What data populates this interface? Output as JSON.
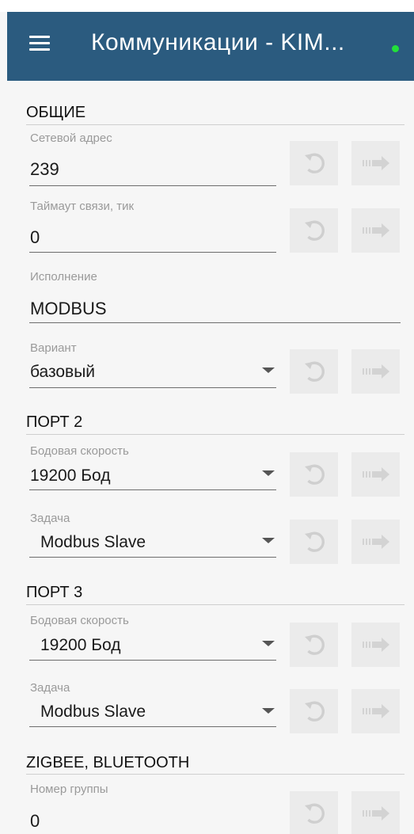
{
  "app_bar": {
    "title": "Коммуникации - KIM...",
    "status_color": "#22e03a"
  },
  "sections": {
    "general": {
      "title": "ОБЩИЕ",
      "network_address": {
        "label": "Сетевой адрес",
        "value": "239"
      },
      "timeout": {
        "label": "Таймаут связи, тик",
        "value": "0"
      },
      "execution": {
        "label": "Исполнение",
        "value": "MODBUS"
      },
      "variant": {
        "label": "Вариант",
        "value": "базовый"
      }
    },
    "port2": {
      "title": "ПОРТ 2",
      "baud_rate": {
        "label": "Бодовая скорость",
        "value": "19200 Бод"
      },
      "task": {
        "label": "Задача",
        "value": "Modbus Slave"
      }
    },
    "port3": {
      "title": "ПОРТ 3",
      "baud_rate": {
        "label": "Бодовая скорость",
        "value": "19200 Бод"
      },
      "task": {
        "label": "Задача",
        "value": "Modbus Slave"
      }
    },
    "zigbee": {
      "title": "ZIGBEE, BLUETOOTH",
      "group_number": {
        "label": "Номер группы",
        "value": "0"
      }
    }
  },
  "icons": {
    "menu": "menu-icon",
    "reset": "undo-icon",
    "apply": "arrow-right-icon"
  },
  "colors": {
    "app_bar": "#2b5b7f",
    "background": "#f6f6f6",
    "button_bg": "#ebebeb",
    "icon_disabled": "#cfcfcf"
  }
}
